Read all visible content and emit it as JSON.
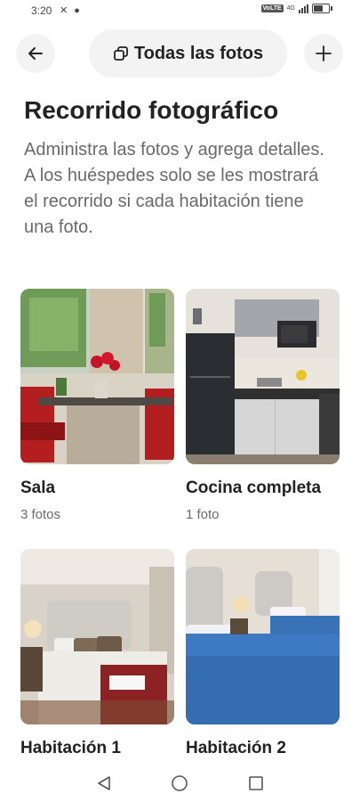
{
  "status_bar": {
    "time": "3:20",
    "notification_icons": "✕ ●",
    "volte": "VoLTE",
    "network": "4G",
    "battery_level": 0.6
  },
  "header": {
    "all_photos_label": "Todas las fotos"
  },
  "main": {
    "title": "Recorrido fotográfico",
    "description": "Administra las fotos y agrega detalles. A los huéspedes solo se les mostrará el recorrido si cada habitación tiene una foto."
  },
  "rooms": [
    {
      "name": "Sala",
      "count": "3 fotos"
    },
    {
      "name": "Cocina completa",
      "count": "1 foto"
    },
    {
      "name": "Habitación 1",
      "count": ""
    },
    {
      "name": "Habitación 2",
      "count": ""
    }
  ],
  "icons": {
    "back": "arrow-left-icon",
    "photos": "photo-stack-icon",
    "add": "plus-icon",
    "nav_back": "triangle-back-icon",
    "nav_home": "circle-home-icon",
    "nav_recent": "square-recent-icon"
  }
}
